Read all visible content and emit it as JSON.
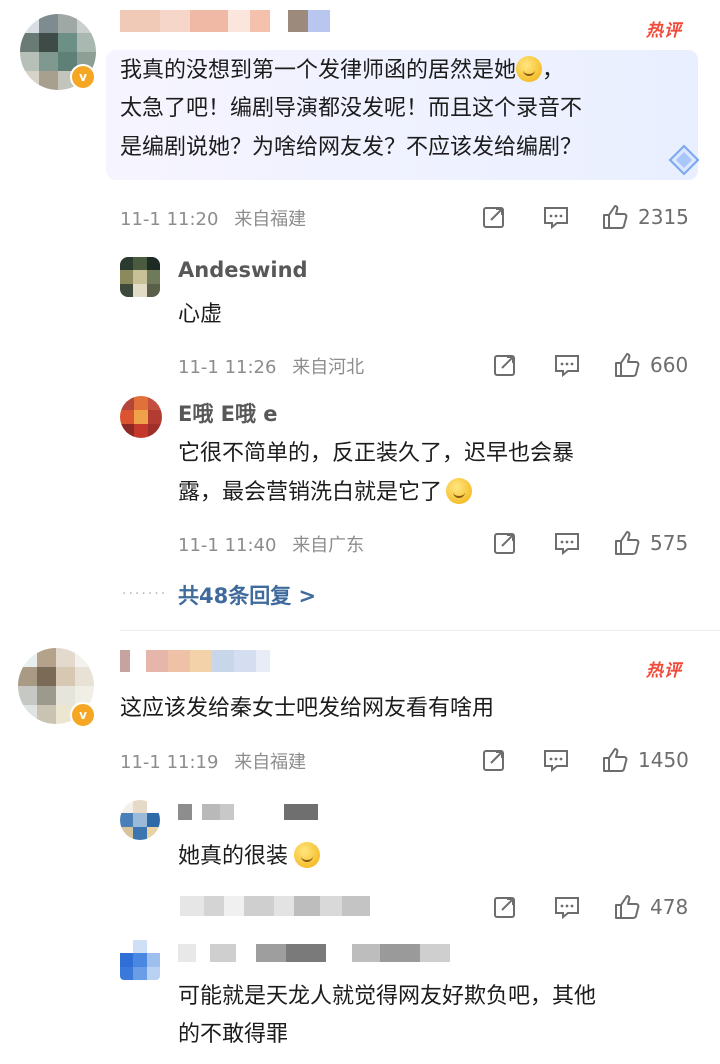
{
  "comments": [
    {
      "hot_label": "热评",
      "text": "我真的没想到第一个发律师函的居然是她😳，太急了吧！编剧导演都没发呢！而且这个录音不是编剧说她？为啥给网友发？不应该发给编剧？",
      "line1": "我真的没想到第一个发律师函的居然是她",
      "line1b": "，",
      "line2": "太急了吧！编剧导演都没发呢！而且这个录音不",
      "line3": "是编剧说她？为啥给网友发？不应该发给编剧？",
      "time": "11-1 11:20",
      "location": "来自福建",
      "likes": "2315",
      "replies": [
        {
          "name": "Andeswind",
          "text": "心虚",
          "time": "11-1 11:26",
          "location": "来自河北",
          "likes": "660"
        },
        {
          "name": "E哦 E哦 e",
          "line1": "它很不简单的，反正装久了，迟早也会暴",
          "line2": "露，最会营销洗白就是它了",
          "time": "11-1 11:40",
          "location": "来自广东",
          "likes": "575"
        }
      ],
      "more_replies": "共48条回复 >"
    },
    {
      "hot_label": "热评",
      "text": "这应该发给秦女士吧发给网友看有啥用",
      "time": "11-1 11:19",
      "location": "来自福建",
      "likes": "1450",
      "replies": [
        {
          "text": "她真的很装",
          "likes": "478"
        },
        {
          "line1": "可能就是天龙人就觉得网友好欺负吧，其他",
          "line2": "的不敢得罪"
        }
      ]
    }
  ],
  "icons": {
    "repost": "share-icon",
    "comment": "comment-icon",
    "like": "like-icon",
    "verified": "verified-badge-icon"
  },
  "colors": {
    "hot": "#f24a3a",
    "link": "#3f6a9c",
    "meta": "#8d8d8d"
  }
}
